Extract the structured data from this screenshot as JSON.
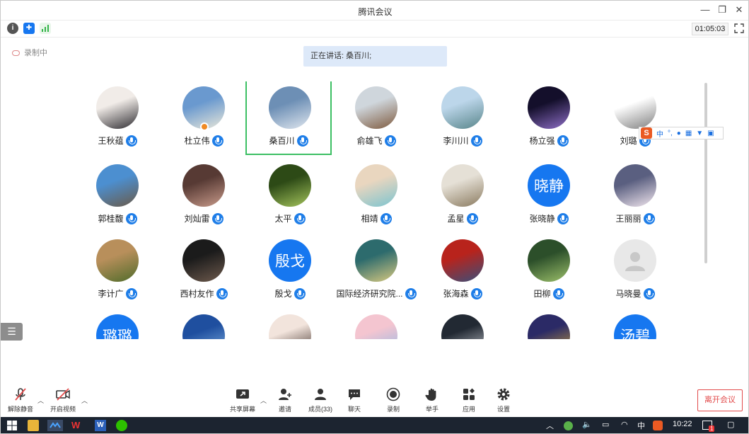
{
  "window": {
    "title": "腾讯会议"
  },
  "topbar": {
    "timer": "01:05:03"
  },
  "recording": {
    "label": "录制中"
  },
  "speaking": {
    "text": "正在讲话: 桑百川;"
  },
  "participants": [
    {
      "name": "王秋蕴",
      "type": "photo",
      "c1": "#f1ece8",
      "c2": "#2d2b30",
      "mic": true
    },
    {
      "name": "杜立伟",
      "type": "photo",
      "c1": "#6a99cf",
      "c2": "#e9e7d9",
      "mic": true,
      "badge": true
    },
    {
      "name": "桑百川",
      "type": "photo",
      "c1": "#6d8fb5",
      "c2": "#dfe6ee",
      "mic": true,
      "highlight": true
    },
    {
      "name": "俞雄飞",
      "type": "photo",
      "c1": "#cfd6dc",
      "c2": "#7e5a3e",
      "mic": true
    },
    {
      "name": "李川川",
      "type": "photo",
      "c1": "#bcd6ea",
      "c2": "#58858a",
      "mic": true
    },
    {
      "name": "杨立强",
      "type": "photo",
      "c1": "#140f2b",
      "c2": "#8f6fc8",
      "mic": true
    },
    {
      "name": "刘璐",
      "type": "photo",
      "c1": "#ffffff",
      "c2": "#808080",
      "mic": true
    },
    {
      "name": "郭桂馥",
      "type": "photo",
      "c1": "#4c8fd0",
      "c2": "#6a5a48",
      "mic": true
    },
    {
      "name": "刘灿雷",
      "type": "photo",
      "c1": "#573a34",
      "c2": "#c89a8a",
      "mic": true
    },
    {
      "name": "太平",
      "type": "photo",
      "c1": "#2d4a16",
      "c2": "#a4c45c",
      "mic": true
    },
    {
      "name": "相靖",
      "type": "photo",
      "c1": "#e9d6bf",
      "c2": "#7bc4d0",
      "mic": true
    },
    {
      "name": "孟星",
      "type": "photo",
      "c1": "#e5e0d6",
      "c2": "#8a7a5f",
      "mic": true
    },
    {
      "name": "张晓静",
      "type": "text",
      "initials": "晓静",
      "c1": "#1677f0",
      "c2": "#1677f0",
      "mic": true
    },
    {
      "name": "王丽丽",
      "type": "photo",
      "c1": "#5a5f80",
      "c2": "#f1e6ee",
      "mic": true
    },
    {
      "name": "李计广",
      "type": "photo",
      "c1": "#b88f5b",
      "c2": "#4f6b2a",
      "mic": true
    },
    {
      "name": "西村友作",
      "type": "photo",
      "c1": "#1b1b1b",
      "c2": "#6e5a4d",
      "mic": true
    },
    {
      "name": "殷戈",
      "type": "text",
      "initials": "殷戈",
      "c1": "#1677f0",
      "c2": "#1677f0",
      "mic": true
    },
    {
      "name": "国际经济研究院...",
      "type": "photo",
      "c1": "#2d6b6d",
      "c2": "#d8c980",
      "mic": true
    },
    {
      "name": "张海森",
      "type": "photo",
      "c1": "#b8231c",
      "c2": "#3a4f7a",
      "mic": true
    },
    {
      "name": "田柳",
      "type": "photo",
      "c1": "#2c4f2a",
      "c2": "#9cc06a",
      "mic": true
    },
    {
      "name": "马晓曼",
      "type": "default",
      "c1": "#e8e8e8",
      "c2": "#e8e8e8",
      "mic": true
    },
    {
      "name": "璐璐",
      "type": "text",
      "initials": "璐璐",
      "c1": "#1677f0",
      "c2": "#1677f0",
      "mic": true
    },
    {
      "name": "",
      "type": "photo",
      "c1": "#1f4f9f",
      "c2": "#7fb0e0",
      "mic": false
    },
    {
      "name": "",
      "type": "photo",
      "c1": "#f2e4dc",
      "c2": "#3b2a24",
      "mic": false
    },
    {
      "name": "",
      "type": "photo",
      "c1": "#f4c5d0",
      "c2": "#8fb7e6",
      "mic": false
    },
    {
      "name": "",
      "type": "photo",
      "c1": "#222933",
      "c2": "#c5c9cf",
      "mic": false
    },
    {
      "name": "",
      "type": "photo",
      "c1": "#2b2a66",
      "c2": "#c9a03a",
      "mic": false
    },
    {
      "name": "",
      "type": "text",
      "initials": "汤碧",
      "c1": "#1677f0",
      "c2": "#1677f0",
      "mic": false
    }
  ],
  "ime": {
    "logo": "S",
    "lang": "中"
  },
  "bottom": {
    "unmute": "解除静音",
    "start_video": "开启视频",
    "share": "共享屏幕",
    "invite": "邀请",
    "members": "成员(33)",
    "chat": "聊天",
    "record": "录制",
    "raise_hand": "举手",
    "apps": "应用",
    "settings": "设置",
    "leave": "离开会议"
  },
  "taskbar": {
    "ime": "中",
    "clock": "10:22",
    "notif": "1"
  },
  "colors": {
    "accent": "#1677f0",
    "highlight": "#3cbf63",
    "leave": "#e24b4b"
  }
}
